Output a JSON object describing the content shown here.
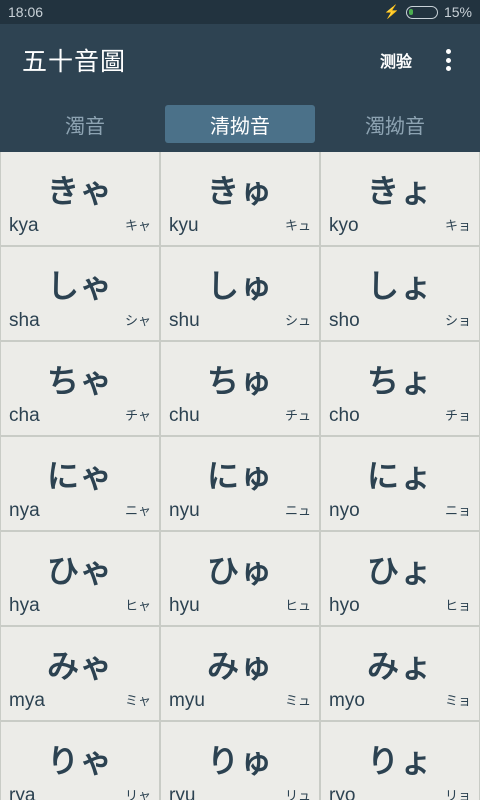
{
  "status_bar": {
    "time": "18:06",
    "battery": "15%",
    "battery_level": 0.15
  },
  "app_bar": {
    "title": "五十音圖",
    "action_label": "测验"
  },
  "tabs": [
    {
      "label": "濁音"
    },
    {
      "label": "清拗音",
      "active": true
    },
    {
      "label": "濁拗音"
    }
  ],
  "grid": [
    {
      "kana": "きゃ",
      "romaji": "kya",
      "katakana": "キャ"
    },
    {
      "kana": "きゅ",
      "romaji": "kyu",
      "katakana": "キュ"
    },
    {
      "kana": "きょ",
      "romaji": "kyo",
      "katakana": "キョ"
    },
    {
      "kana": "しゃ",
      "romaji": "sha",
      "katakana": "シャ"
    },
    {
      "kana": "しゅ",
      "romaji": "shu",
      "katakana": "シュ"
    },
    {
      "kana": "しょ",
      "romaji": "sho",
      "katakana": "ショ"
    },
    {
      "kana": "ちゃ",
      "romaji": "cha",
      "katakana": "チャ"
    },
    {
      "kana": "ちゅ",
      "romaji": "chu",
      "katakana": "チュ"
    },
    {
      "kana": "ちょ",
      "romaji": "cho",
      "katakana": "チョ"
    },
    {
      "kana": "にゃ",
      "romaji": "nya",
      "katakana": "ニャ"
    },
    {
      "kana": "にゅ",
      "romaji": "nyu",
      "katakana": "ニュ"
    },
    {
      "kana": "にょ",
      "romaji": "nyo",
      "katakana": "ニョ"
    },
    {
      "kana": "ひゃ",
      "romaji": "hya",
      "katakana": "ヒャ"
    },
    {
      "kana": "ひゅ",
      "romaji": "hyu",
      "katakana": "ヒュ"
    },
    {
      "kana": "ひょ",
      "romaji": "hyo",
      "katakana": "ヒョ"
    },
    {
      "kana": "みゃ",
      "romaji": "mya",
      "katakana": "ミャ"
    },
    {
      "kana": "みゅ",
      "romaji": "myu",
      "katakana": "ミュ"
    },
    {
      "kana": "みょ",
      "romaji": "myo",
      "katakana": "ミョ"
    },
    {
      "kana": "りゃ",
      "romaji": "rya",
      "katakana": "リャ"
    },
    {
      "kana": "りゅ",
      "romaji": "ryu",
      "katakana": "リュ"
    },
    {
      "kana": "りょ",
      "romaji": "ryo",
      "katakana": "リョ"
    }
  ]
}
